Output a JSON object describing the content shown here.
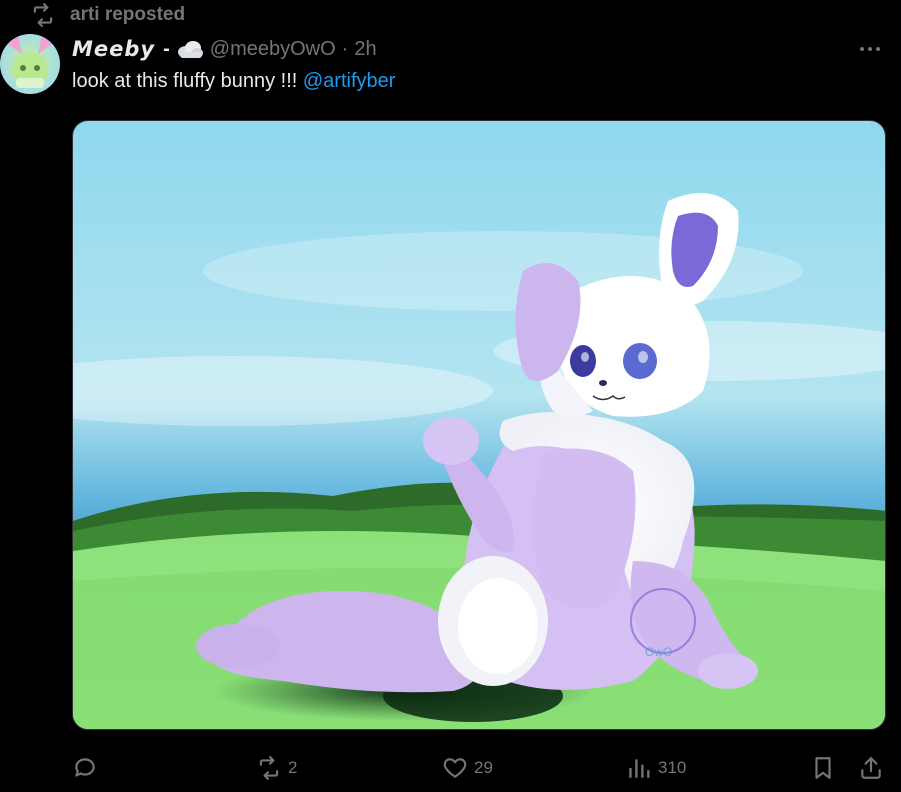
{
  "repost": {
    "icon": "repost-icon",
    "text": "arti reposted"
  },
  "author": {
    "display_name": "Meeby",
    "display_suffix": "-",
    "emoji_icon": "cloud-icon",
    "handle": "@meebyOwO",
    "separator": "·",
    "time": "2h"
  },
  "tweet": {
    "text": "look at this fluffy bunny !!!",
    "mention": "@artifyber"
  },
  "media": {
    "watermark_text": "OwO"
  },
  "actions": {
    "reply": {
      "icon": "reply-icon",
      "count": ""
    },
    "repost": {
      "icon": "repost-icon",
      "count": "2"
    },
    "like": {
      "icon": "heart-icon",
      "count": "29"
    },
    "views": {
      "icon": "views-icon",
      "count": "310"
    },
    "bookmark": {
      "icon": "bookmark-icon"
    },
    "share": {
      "icon": "share-icon"
    }
  },
  "colors": {
    "background": "#000000",
    "text_primary": "#e7e9ea",
    "text_secondary": "#71767b",
    "accent": "#1d9bf0"
  }
}
